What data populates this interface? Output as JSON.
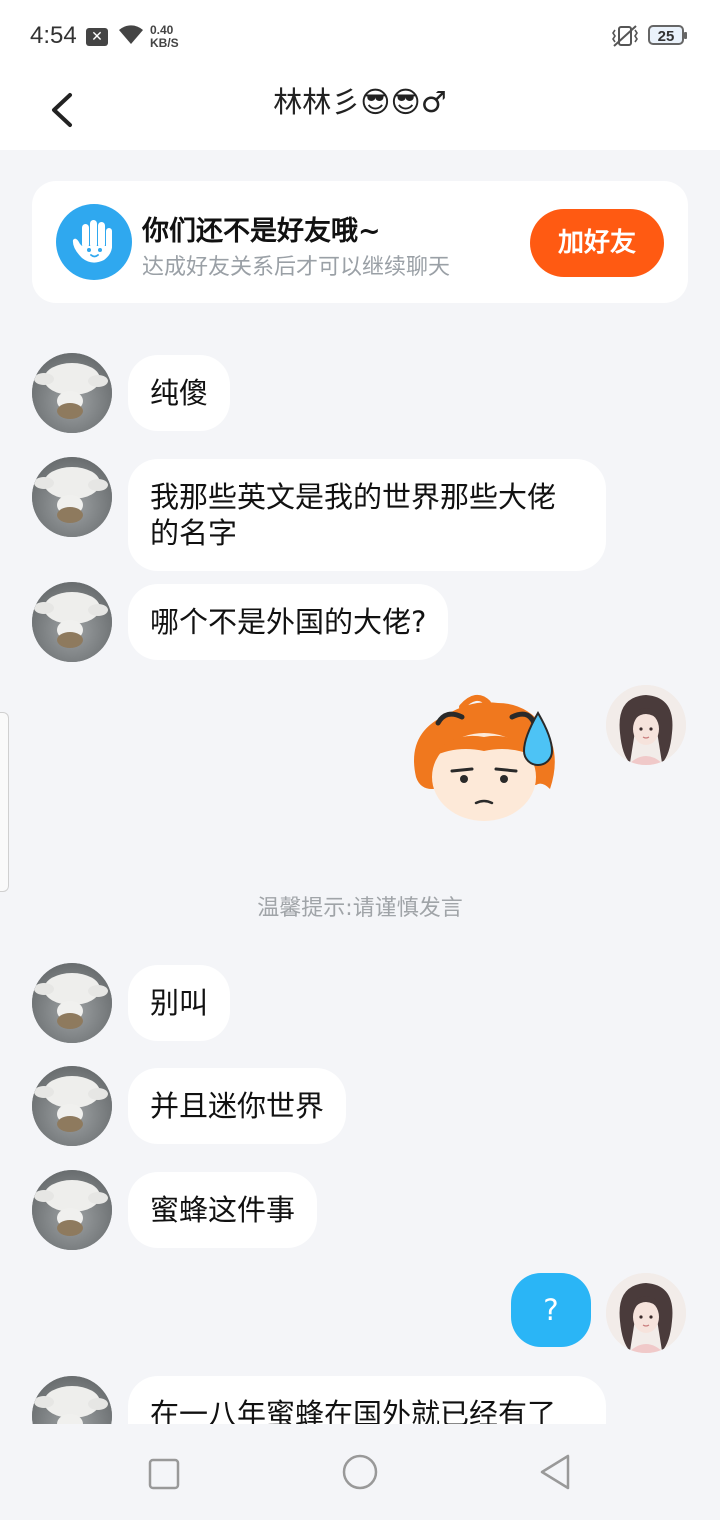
{
  "status_bar": {
    "time": "4:54",
    "notif_icon": "x-icon",
    "net_speed_value": "0.40",
    "net_speed_unit": "KB/S",
    "battery": "25"
  },
  "header": {
    "title": "林林彡😎😎♂",
    "back_icon": "chevron-left-icon"
  },
  "friend_card": {
    "title": "你们还不是好友哦~",
    "subtitle": "达成好友关系后才可以继续聊天",
    "button": "加好友",
    "button_color": "#ff5a12"
  },
  "messages": [
    {
      "side": "left",
      "text": "纯傻"
    },
    {
      "side": "left",
      "text": "我那些英文是我的世界那些大佬的名字"
    },
    {
      "side": "left",
      "text": "哪个不是外国的大佬?"
    },
    {
      "side": "right",
      "type": "sticker",
      "sticker": "annoyed-character-sticker"
    },
    {
      "side": "left",
      "text": "别叫"
    },
    {
      "side": "left",
      "text": "并且迷你世界"
    },
    {
      "side": "left",
      "text": "蜜蜂这件事"
    },
    {
      "side": "right",
      "text": "?"
    },
    {
      "side": "left",
      "text": "在一八年蜜蜂在国外就已经有了"
    }
  ],
  "tip": "温馨提示:请谨慎发言",
  "colors": {
    "background": "#f4f5f8",
    "my_bubble": "#2ab5f6",
    "accent": "#ff5a12"
  },
  "nav": {
    "icons": [
      "square-recent-apps-icon",
      "circle-home-icon",
      "triangle-back-icon"
    ]
  }
}
